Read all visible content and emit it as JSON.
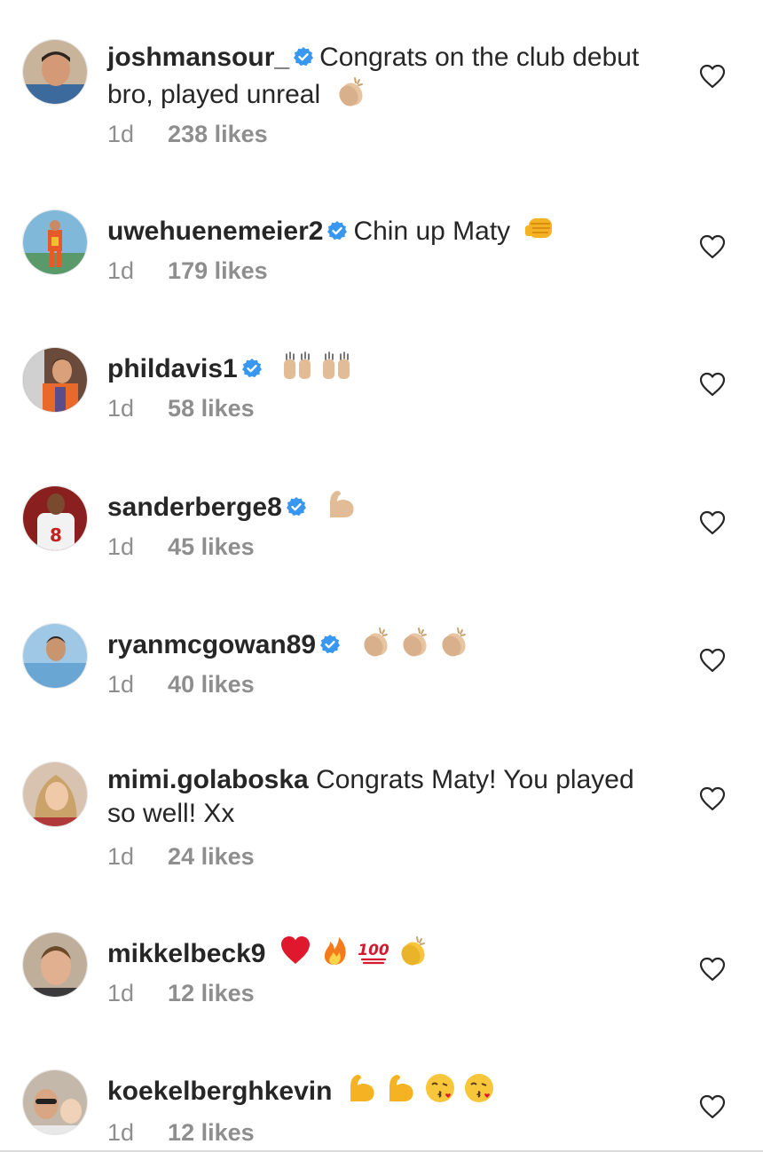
{
  "comments": [
    {
      "username": "joshmansour_",
      "verified": true,
      "text": "Congrats on the club debut bro, played unreal",
      "emojis": [
        "clapping-hands"
      ],
      "time": "1d",
      "likes": "238 likes"
    },
    {
      "username": "uwehuenemeier2",
      "verified": true,
      "text": "Chin up Maty",
      "emojis": [
        "fist-bump"
      ],
      "time": "1d",
      "likes": "179 likes"
    },
    {
      "username": "phildavis1",
      "verified": true,
      "text": "",
      "emojis": [
        "raising-hands",
        "raising-hands"
      ],
      "time": "1d",
      "likes": "58 likes"
    },
    {
      "username": "sanderberge8",
      "verified": true,
      "text": "",
      "emojis": [
        "flexed-biceps"
      ],
      "time": "1d",
      "likes": "45 likes"
    },
    {
      "username": "ryanmcgowan89",
      "verified": true,
      "text": "",
      "emojis": [
        "clapping-hands",
        "clapping-hands",
        "clapping-hands"
      ],
      "time": "1d",
      "likes": "40 likes"
    },
    {
      "username": "mimi.golaboska",
      "verified": false,
      "text": "Congrats Maty! You played so well! Xx",
      "emojis": [],
      "time": "1d",
      "likes": "24 likes"
    },
    {
      "username": "mikkelbeck9",
      "verified": false,
      "text": "",
      "emojis": [
        "red-heart",
        "fire",
        "hundred-points",
        "clapping-hands"
      ],
      "time": "1d",
      "likes": "12 likes"
    },
    {
      "username": "koekelberghkevin",
      "verified": false,
      "text": "",
      "emojis": [
        "flexed-biceps",
        "flexed-biceps",
        "kissing-face",
        "kissing-face"
      ],
      "time": "1d",
      "likes": "12 likes"
    }
  ],
  "icons": {
    "like": "heart-outline-icon",
    "verified": "verified-badge-icon"
  },
  "colors": {
    "text": "#262626",
    "secondary": "#8e8e8e",
    "verified": "#3897f0",
    "heart_outline": "#262626"
  }
}
